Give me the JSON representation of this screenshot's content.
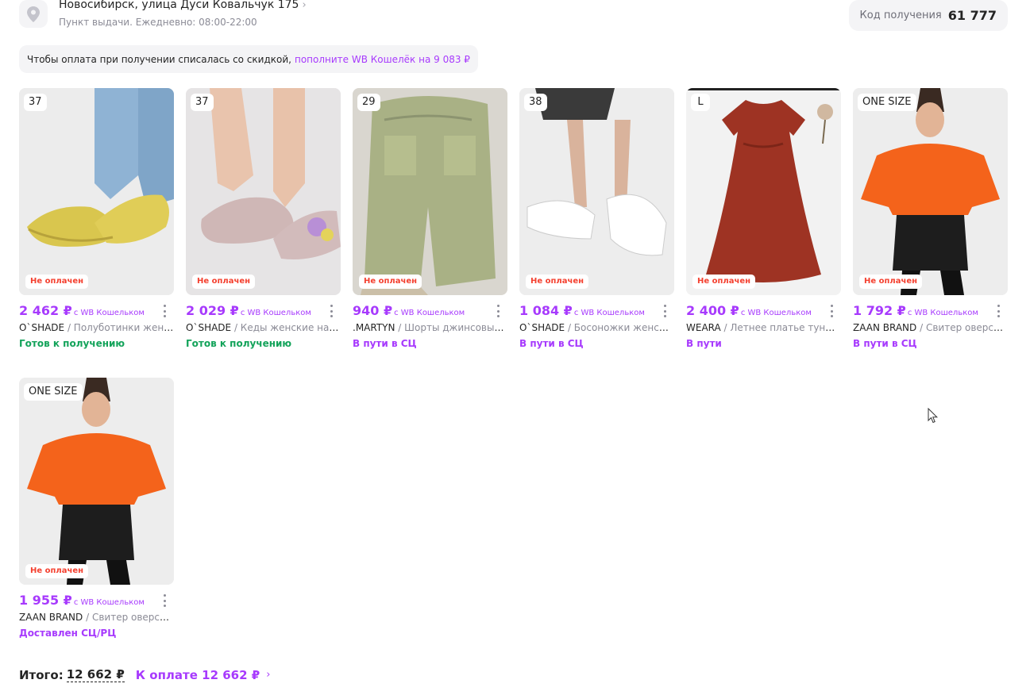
{
  "pickup": {
    "address": "Новосибирск, улица Дуси Ковальчук 175",
    "address_chevron": "›",
    "schedule": "Пункт выдачи. Ежедневно: 08:00-22:00",
    "code_label": "Код получения",
    "code_value": "61 777",
    "icon": "location-pin-icon"
  },
  "notice": {
    "text": "Чтобы оплата при получении списалась со скидкой,",
    "link": "пополните WB Кошелёк на 9 083 ₽"
  },
  "colors": {
    "accent": "#a73afd",
    "ready": "#13a35a",
    "unpaid": "#f4402f",
    "muted": "#8b8b96"
  },
  "products": [
    {
      "size": "37",
      "badge": "Не оплачен",
      "price": "2 462 ₽",
      "price_note": "с WB Кошельком",
      "brand": "O`SHADE",
      "name": " / Полуботинки женские",
      "status": "Готов к получению",
      "status_color": "#13a35a",
      "image": "yellow-shoes"
    },
    {
      "size": "37",
      "badge": "Не оплачен",
      "price": "2 029 ₽",
      "price_note": "с WB Кошельком",
      "brand": "O`SHADE",
      "name": " / Кеды женские натуральная кожа",
      "status": "Готов к получению",
      "status_color": "#13a35a",
      "image": "pink-sneakers"
    },
    {
      "size": "29",
      "badge": "Не оплачен",
      "price": "940 ₽",
      "price_note": "с WB Кошельком",
      "brand": ".MARTYN",
      "name": " / Шорты джинсовые длинные",
      "status": "В пути в СЦ",
      "status_color": "#a73afd",
      "image": "denim-shorts"
    },
    {
      "size": "38",
      "badge": "Не оплачен",
      "price": "1 084 ₽",
      "price_note": "с WB Кошельком",
      "brand": "O`SHADE",
      "name": " / Босоножки женские",
      "status": "В пути в СЦ",
      "status_color": "#a73afd",
      "image": "white-sandals"
    },
    {
      "size": "L",
      "badge": "Не оплачен",
      "price": "2 400 ₽",
      "price_note": "с WB Кошельком",
      "brand": "WEARA",
      "name": " / Летнее платье туника",
      "status": "В пути",
      "status_color": "#a73afd",
      "image": "red-dress"
    },
    {
      "size": "ONE SIZE",
      "badge": "Не оплачен",
      "price": "1 792 ₽",
      "price_note": "с WB Кошельком",
      "brand": "ZAAN BRAND",
      "name": " / Свитер оверсайз",
      "status": "В пути в СЦ",
      "status_color": "#a73afd",
      "image": "orange-sweater"
    },
    {
      "size": "ONE SIZE",
      "badge": "Не оплачен",
      "price": "1 955 ₽",
      "price_note": "с WB Кошельком",
      "brand": "ZAAN BRAND",
      "name": " / Свитер оверсайз",
      "status": "Доставлен СЦ/РЦ",
      "status_color": "#a73afd",
      "image": "orange-sweater"
    }
  ],
  "total": {
    "label": "Итого:",
    "sum": "12 662 ₽",
    "pay_label": "К оплате 12 662 ₽",
    "arrow": "›"
  }
}
